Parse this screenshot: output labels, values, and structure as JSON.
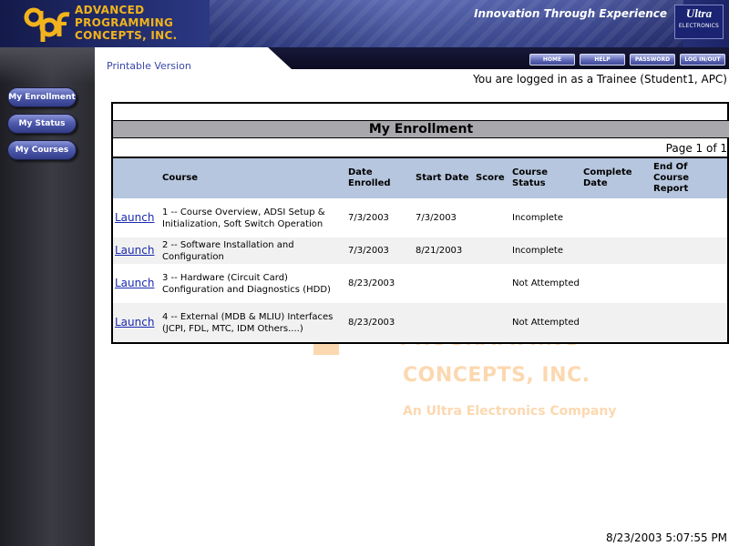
{
  "header": {
    "company_lines": [
      "ADVANCED",
      "PROGRAMMING",
      "CONCEPTS, INC."
    ],
    "tagline": "Innovation Through Experience",
    "partner_logo": {
      "big": "Ultra",
      "small": "ELECTRONICS"
    },
    "brand_color": "#f2b31c"
  },
  "sidebar": {
    "items": [
      {
        "label": "My Enrollment"
      },
      {
        "label": "My Status"
      },
      {
        "label": "My Courses"
      }
    ]
  },
  "topnav": {
    "printable_label": "Printable Version",
    "buttons": [
      {
        "label": "HOME"
      },
      {
        "label": "HELP"
      },
      {
        "label": "PASSWORD"
      },
      {
        "label": "LOG IN/OUT"
      }
    ]
  },
  "main": {
    "logged_in_text": "You are logged in as a Trainee (Student1, APC)",
    "section_title": "My Enrollment",
    "page_info": "Page 1 of 1",
    "watermark": {
      "line1": "PROGRAMMING",
      "line2": "CONCEPTS, INC.",
      "line3": "An Ultra Electronics Company"
    },
    "table": {
      "headers": [
        "",
        "Course",
        "Date Enrolled",
        "Start Date",
        "Score",
        "Course Status",
        "Complete Date",
        "End Of Course Report"
      ],
      "rows": [
        {
          "launch": "Launch",
          "course": "1 -- Course Overview, ADSI Setup & Initialization, Soft Switch Operation",
          "date_enrolled": "7/3/2003",
          "start_date": "7/3/2003",
          "score": "",
          "status": "Incomplete",
          "complete_date": "",
          "report": ""
        },
        {
          "launch": "Launch",
          "course": "2 -- Software Installation and Configuration",
          "date_enrolled": "7/3/2003",
          "start_date": "8/21/2003",
          "score": "",
          "status": "Incomplete",
          "complete_date": "",
          "report": ""
        },
        {
          "launch": "Launch",
          "course": "3 -- Hardware (Circuit Card) Configuration and Diagnostics (HDD)",
          "date_enrolled": "8/23/2003",
          "start_date": "",
          "score": "",
          "status": "Not Attempted",
          "complete_date": "",
          "report": ""
        },
        {
          "launch": "Launch",
          "course": "4 -- External (MDB & MLIU) Interfaces (JCPI, FDL, MTC, IDM Others....)",
          "date_enrolled": "8/23/2003",
          "start_date": "",
          "score": "",
          "status": "Not Attempted",
          "complete_date": "",
          "report": ""
        }
      ]
    },
    "timestamp": "8/23/2003 5:07:55 PM"
  }
}
